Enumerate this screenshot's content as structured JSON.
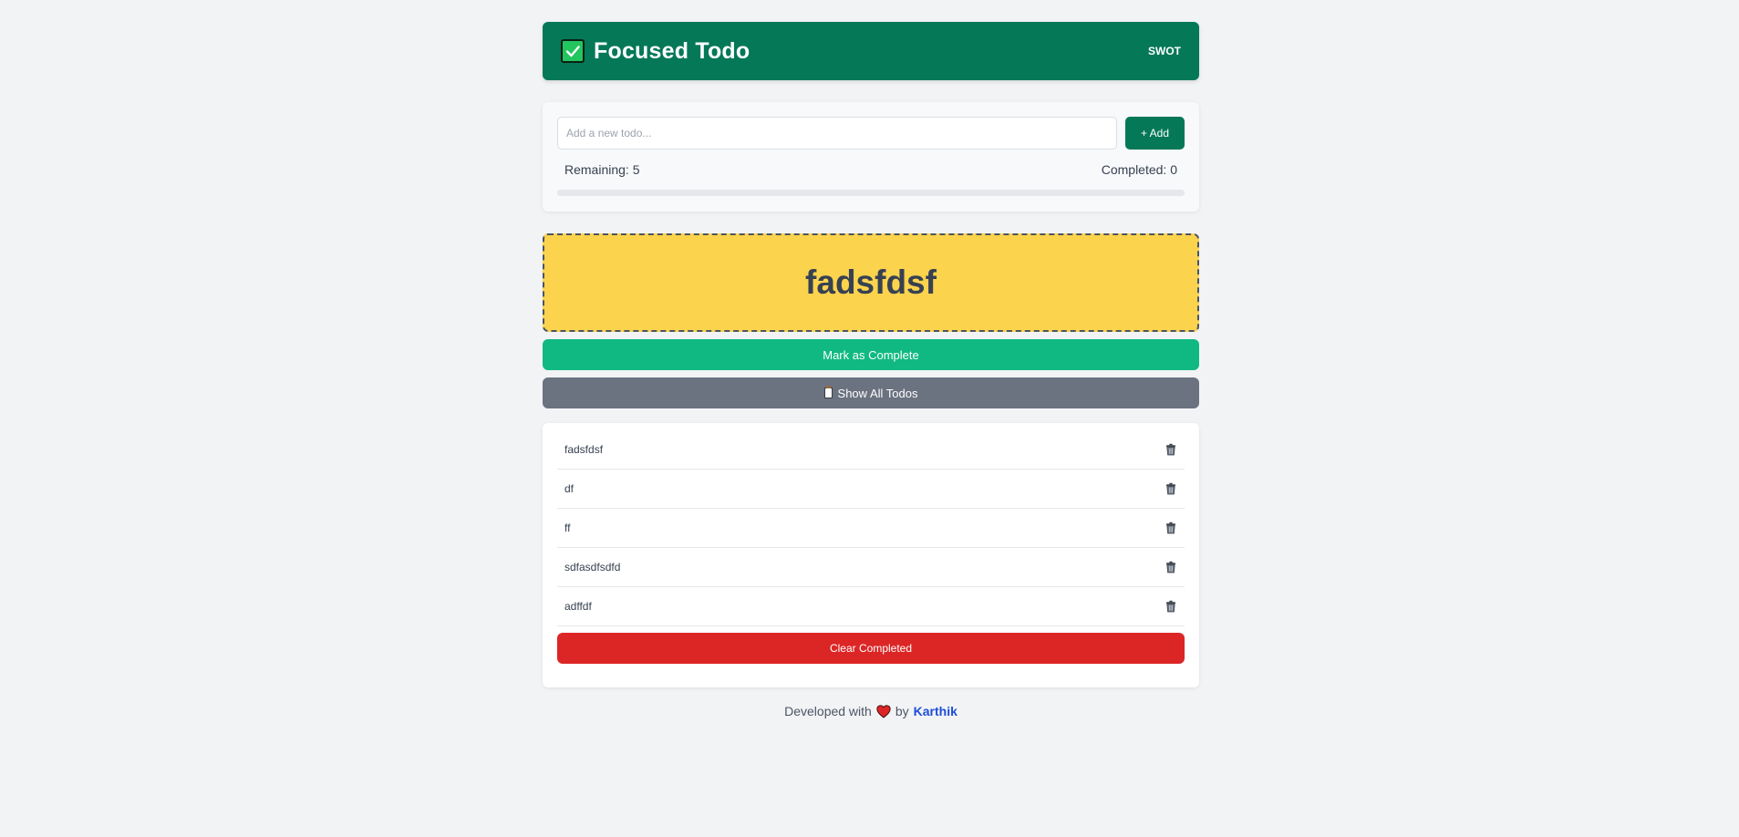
{
  "header": {
    "title": "Focused Todo",
    "link": "SWOT",
    "icon": "checkmark-icon",
    "color": "#047857"
  },
  "input": {
    "placeholder": "Add a new todo...",
    "value": "",
    "add_label": "+ Add"
  },
  "stats": {
    "remaining_text": "Remaining: 5",
    "completed_text": "Completed: 0",
    "progress_fraction": 0
  },
  "focus": {
    "text": "fadsfdsf"
  },
  "actions": {
    "mark_complete": "Mark as Complete",
    "show_all": "Show All Todos",
    "clear_completed": "Clear Completed"
  },
  "todos": [
    {
      "text": "fadsfdsf"
    },
    {
      "text": "df"
    },
    {
      "text": "ff"
    },
    {
      "text": "sdfasdfsdfd"
    },
    {
      "text": "adffdf"
    }
  ],
  "footer": {
    "prefix": "Developed with",
    "by": "by",
    "author": "Karthik"
  },
  "colors": {
    "accent": "#047857",
    "focus_bg": "#fcd34d",
    "complete": "#10b981",
    "secondary": "#6b7280",
    "danger": "#dc2626",
    "link": "#1d4ed8"
  }
}
